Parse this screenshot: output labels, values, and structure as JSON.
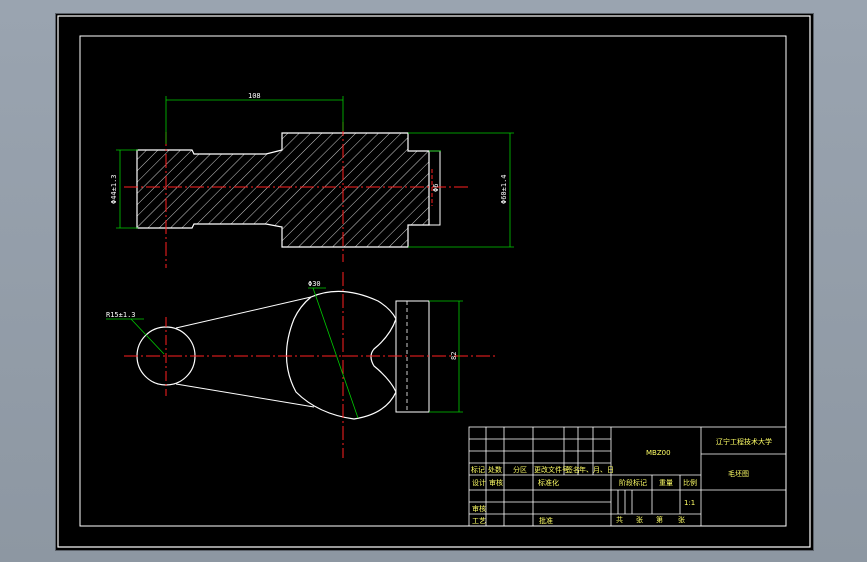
{
  "drawing": {
    "top_view_dims": {
      "width_label": "108",
      "left_dia_label": "Φ44±1.3",
      "mid_dia_label": "Φ6",
      "right_dia_label": "Φ60±1.4"
    },
    "bottom_view_dims": {
      "left_hole_label": "R15±1.3",
      "big_arc_label": "Φ30",
      "right_height_label": "82"
    }
  },
  "title_block": {
    "part_code": "MBZ00",
    "school": "辽宁工程技术大学",
    "drawing_name": "毛坯图",
    "ratio": "1:1",
    "row_labels": {
      "mark": "标记",
      "count": "处数",
      "zone": "分区",
      "change_doc": "更改文件号",
      "sign": "签名",
      "date": "年、月、日"
    },
    "design": "设计",
    "standardize": "标准化",
    "review": "审核",
    "stage_mark": "阶段标记",
    "weight": "重量",
    "scale": "比例",
    "craft": "工艺",
    "approve": "批准",
    "sheet_total": "共",
    "sheet_unit": "张",
    "sheet_no": "第",
    "sheet_unit2": "张"
  }
}
